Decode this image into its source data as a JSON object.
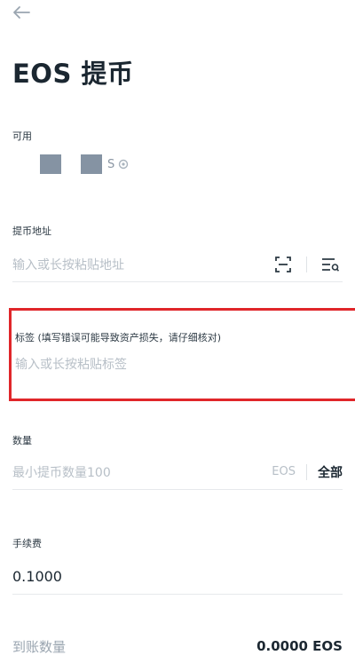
{
  "header": {
    "title": "EOS 提币"
  },
  "available": {
    "label": "可用",
    "unit": "S"
  },
  "address": {
    "label": "提币地址",
    "placeholder": "输入或长按粘贴地址"
  },
  "memo": {
    "label": "标签 (填写错误可能导致资产损失，请仔细核对)",
    "placeholder": "输入或长按粘贴标签"
  },
  "amount": {
    "label": "数量",
    "placeholder": "最小提币数量100",
    "unit": "EOS",
    "all_label": "全部"
  },
  "fee": {
    "label": "手续费",
    "value": "0.1000"
  },
  "receive": {
    "label": "到账数量",
    "value": "0.0000 EOS"
  },
  "colors": {
    "highlight": "#e0262a",
    "text": "#1b2731",
    "placeholder": "#b7bfc7"
  }
}
